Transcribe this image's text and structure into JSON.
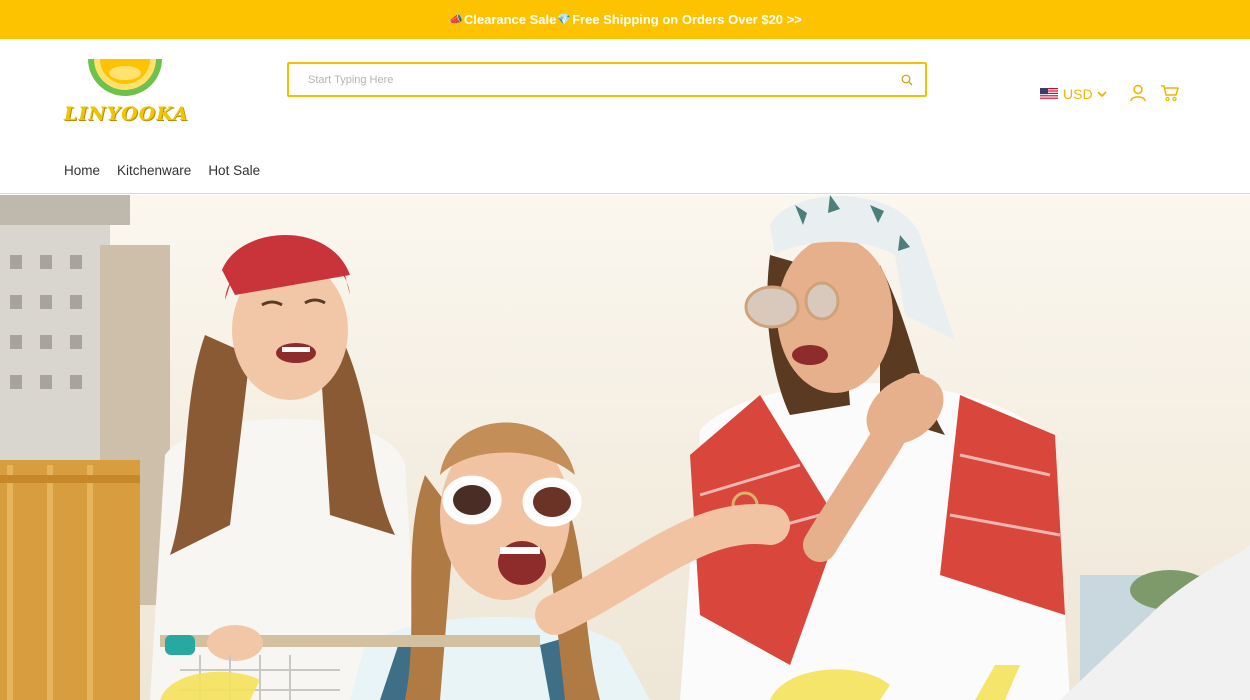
{
  "announcement": {
    "text": "Clearance Sale Free Shipping on Orders Over $20 >>",
    "part1": "Clearance Sale",
    "part2": "Free Shipping on Orders Over $20 >>",
    "icon1": "megaphone-icon",
    "icon2": "money-icon"
  },
  "logo": {
    "text": "LINYOOKA",
    "icon": "lemon-slice-icon"
  },
  "search": {
    "placeholder": "Start Typing Here",
    "value": "",
    "icon": "search-icon"
  },
  "currency": {
    "code": "USD",
    "flag": "us-flag-icon"
  },
  "header_icons": [
    "account-icon",
    "cart-icon"
  ],
  "nav": {
    "items": [
      "Home",
      "Kitchenware",
      "Hot Sale"
    ]
  },
  "hero": {
    "image": "three laughing young women with a shopping cart outdoors"
  },
  "colors": {
    "accent": "#fdc300",
    "logo": "#f0c400",
    "nav_text": "#333333",
    "search_border": "#f2c100"
  }
}
